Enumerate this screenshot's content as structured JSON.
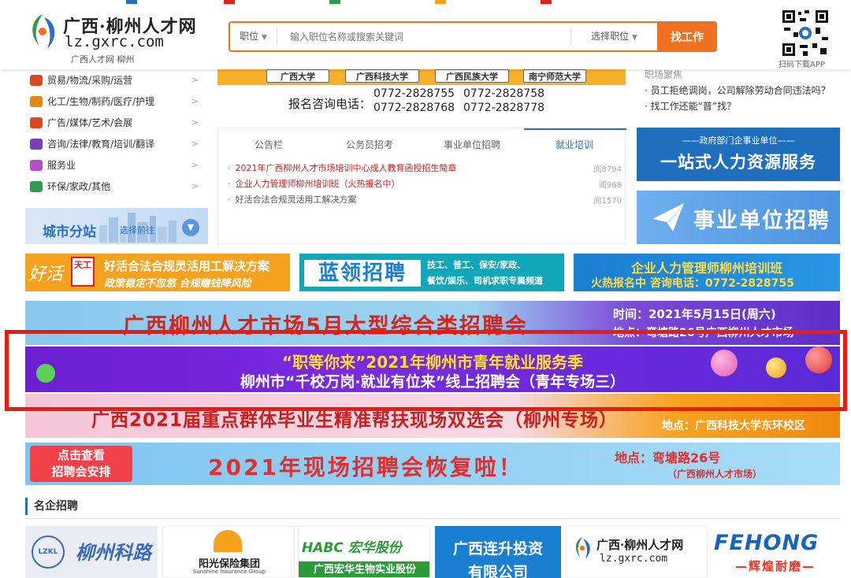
{
  "header": {
    "logo_cn": "广西·柳州人才网",
    "logo_en": "lz.gxrc.com",
    "logo_sub": "广西人才网   柳州",
    "search": {
      "category_label": "职位",
      "placeholder": "输入职位名称或搜索关键词",
      "position_label": "选择职位",
      "button_label": "找工作"
    },
    "qr_label": "扫码下载APP"
  },
  "categories": [
    {
      "label": "贸易/物流/采购/运营",
      "color": "#d9481f"
    },
    {
      "label": "化工/生物/制药/医疗/护理",
      "color": "#e8861a"
    },
    {
      "label": "广告/媒体/艺术/会展",
      "color": "#d9481f"
    },
    {
      "label": "咨询/法律/教育/培训/翻译",
      "color": "#7b3fb5"
    },
    {
      "label": "服务业",
      "color": "#b34fc9"
    },
    {
      "label": "环保/家政/其他",
      "color": "#2e9b4e"
    }
  ],
  "city": {
    "title": "城市分站",
    "link": "选择前往"
  },
  "universities": {
    "tags": [
      "广西大学",
      "广西科技大学",
      "广西民族大学",
      "南宁师范大学"
    ],
    "phone_label": "报名咨询电话：",
    "phones": [
      "0772-2828755",
      "0772-2828758",
      "0772-2828768",
      "0772-2828778"
    ]
  },
  "news": {
    "tabs": [
      "公告栏",
      "公务员招考",
      "事业单位招聘",
      "就业培训"
    ],
    "active_tab": "就业培训",
    "items": [
      {
        "title": "2021年广西柳州人才市场培训中心成人教育函授招生简章",
        "views": "阅8794",
        "color": "#cc1f1f"
      },
      {
        "title": "企业人力管理师柳州培训班（火热报名中）",
        "views": "阅968",
        "color": "#cc1f1f"
      },
      {
        "title": "好活合法合规灵活用工解决方案",
        "views": "阅1570",
        "color": "#555555"
      }
    ]
  },
  "right_news": [
    "职场聚焦",
    "员工拒绝调岗，公司解除劳动合同违法吗？",
    "找工作还能“普”找？"
  ],
  "right_banners": {
    "gov_small": "——政府部门企事业单位——",
    "gov_big": "一站式人力资源服务",
    "inst": "事业单位招聘"
  },
  "promo_banners": {
    "p1_logo": "好活",
    "p1_stamp": "天工",
    "p1_line1": "好活合法合规灵活用工解决方案",
    "p1_line2": "政策稳定不忽悠  合规赚钱降风险",
    "p2_big": "蓝领招聘",
    "p2_line1": "技工、普工、保安/家政、",
    "p2_line2": "餐饮/娱乐、司机求职专属频道",
    "p3_line1": "企业人力管理师柳州培训班",
    "p3_line2": "火热报名中  咨询电话：0772-2828755"
  },
  "wide_banners": {
    "w1_title": "广西柳州人才市场5月大型综合类招聘会",
    "w1_date": "时间：2021年5月15日(周六)",
    "w1_place": "地点：弯塘路26号广西柳州人才市场",
    "w2_line1": "“职等你来”2021年柳州市青年就业服务季",
    "w2_line2": "柳州市“千校万岗·就业有位来”线上招聘会（青年专场三）",
    "w3_title": "广西2021届重点群体毕业生精准帮扶现场双选会（柳州专场）",
    "w3_place": "地点：广西科技大学东环校区",
    "w4_button_l1": "点击查看",
    "w4_button_l2": "招聘会安排",
    "w4_title": "2021年现场招聘会恢复啦！",
    "w4_place": "地点：弯塘路26号",
    "w4_place_sub": "（广西柳州人才市场）"
  },
  "companies": {
    "section_title": "名企招聘",
    "c1_mark": "LZKL",
    "c1_name": "柳州科路",
    "c2_name": "阳光保险集团",
    "c2_en": "Sunshine Insurance Group",
    "c3_name": "HABC 宏华股份",
    "c3_bar": "广西宏华生物实业股份",
    "c4_line1": "广西连升投资",
    "c4_line2": "有限公司",
    "c5_cn": "广西·柳州人才网",
    "c5_en": "lz.gxrc.com",
    "c6_name": "FEHONG",
    "c6_slogan": "—辉煌耐磨—"
  },
  "colors": {
    "brand_orange": "#f0711f",
    "brand_blue": "#2a6fc0",
    "highlight_red": "#e81c10"
  }
}
